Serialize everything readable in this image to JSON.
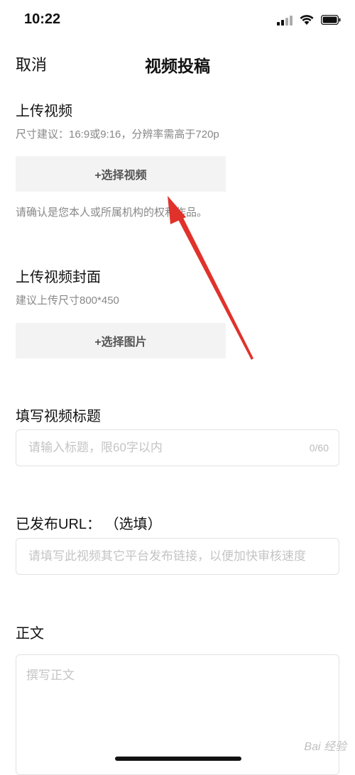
{
  "status_bar": {
    "time": "10:22"
  },
  "nav": {
    "cancel_label": "取消",
    "title": "视频投稿"
  },
  "upload_video": {
    "heading": "上传视频",
    "hint": "尺寸建议：16:9或9:16，分辨率需高于720p",
    "button_label": "+选择视频",
    "notice": "请确认是您本人或所属机构的权利作品。"
  },
  "upload_cover": {
    "heading": "上传视频封面",
    "hint": "建议上传尺寸800*450",
    "button_label": "+选择图片"
  },
  "title_field": {
    "heading": "填写视频标题",
    "placeholder": "请输入标题，限60字以内",
    "counter": "0/60"
  },
  "url_field": {
    "heading": "已发布URL： （选填）",
    "placeholder": "请填写此视频其它平台发布链接，以便加快审核速度"
  },
  "body_field": {
    "heading": "正文",
    "placeholder": "撰写正文"
  },
  "watermark": "Bai 经验",
  "colors": {
    "annotation_arrow": "#e0322b",
    "picker_bg": "#f3f3f3"
  }
}
